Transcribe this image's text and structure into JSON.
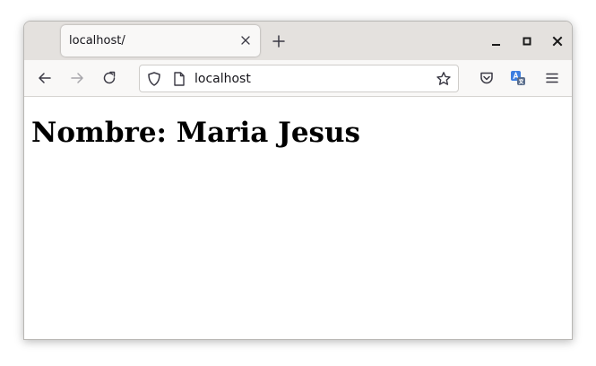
{
  "browser": {
    "tab": {
      "title": "localhost/",
      "close_icon": "close-icon"
    },
    "new_tab_icon": "plus-icon",
    "window_controls": [
      "minimize-icon",
      "maximize-icon",
      "close-icon"
    ],
    "nav": {
      "back_icon": "arrow-left-icon",
      "forward_icon": "arrow-right-icon",
      "reload_icon": "reload-icon",
      "url": "localhost",
      "shield_icon": "shield-icon",
      "page_icon": "page-icon",
      "bookmark_icon": "star-icon",
      "pocket_icon": "pocket-icon",
      "translate_icon": "translate-icon",
      "menu_icon": "hamburger-menu-icon"
    }
  },
  "page": {
    "heading": "Nombre: Maria Jesus"
  },
  "colors": {
    "tabbar_bg": "#e4e1de",
    "toolbar_bg": "#f9f8f7",
    "text": "#15141a",
    "translate_accent": "#3d7ee0"
  }
}
